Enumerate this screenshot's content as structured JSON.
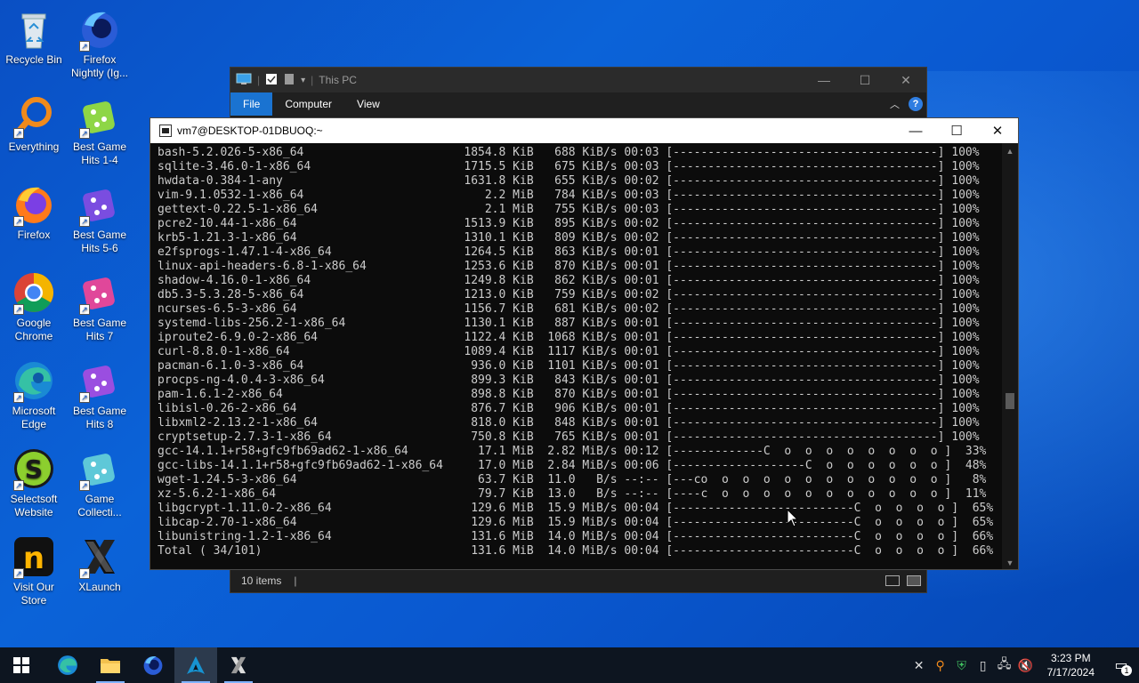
{
  "desktop": {
    "icons": [
      {
        "label": "Recycle Bin",
        "icon": "recycle-bin-icon"
      },
      {
        "label": "Firefox Nightly (Ig...",
        "icon": "firefox-nightly-icon"
      },
      {
        "label": "Everything",
        "icon": "everything-search-icon"
      },
      {
        "label": "Best Game Hits 1-4",
        "icon": "game-dice-icon"
      },
      {
        "label": "Firefox",
        "icon": "firefox-icon"
      },
      {
        "label": "Best Game Hits 5-6",
        "icon": "game-dice-icon"
      },
      {
        "label": "Google Chrome",
        "icon": "chrome-icon"
      },
      {
        "label": "Best Game Hits 7",
        "icon": "game-dice-icon"
      },
      {
        "label": "Microsoft Edge",
        "icon": "edge-icon"
      },
      {
        "label": "Best Game Hits 8",
        "icon": "game-dice-icon"
      },
      {
        "label": "Selectsoft Website",
        "icon": "selectsoft-icon"
      },
      {
        "label": "Game Collecti...",
        "icon": "game-dice-icon"
      },
      {
        "label": "Visit Our Store",
        "icon": "store-icon"
      },
      {
        "label": "XLaunch",
        "icon": "xlaunch-icon"
      }
    ]
  },
  "explorer": {
    "title": "This PC",
    "tabs": [
      "File",
      "Computer",
      "View"
    ],
    "status": "10 items",
    "status_sep": "|",
    "help_label": "?"
  },
  "terminal": {
    "title": "vm7@DESKTOP-01DBUOQ:~",
    "lines": [
      "bash-5.2.026-5-x86_64                       1854.8 KiB   688 KiB/s 00:03 [--------------------------------------] 100%",
      "sqlite-3.46.0-1-x86_64                      1715.5 KiB   675 KiB/s 00:03 [--------------------------------------] 100%",
      "hwdata-0.384-1-any                          1631.8 KiB   655 KiB/s 00:02 [--------------------------------------] 100%",
      "vim-9.1.0532-1-x86_64                          2.2 MiB   784 KiB/s 00:03 [--------------------------------------] 100%",
      "gettext-0.22.5-1-x86_64                        2.1 MiB   755 KiB/s 00:03 [--------------------------------------] 100%",
      "pcre2-10.44-1-x86_64                        1513.9 KiB   895 KiB/s 00:02 [--------------------------------------] 100%",
      "krb5-1.21.3-1-x86_64                        1310.1 KiB   809 KiB/s 00:02 [--------------------------------------] 100%",
      "e2fsprogs-1.47.1-4-x86_64                   1264.5 KiB   863 KiB/s 00:01 [--------------------------------------] 100%",
      "linux-api-headers-6.8-1-x86_64              1253.6 KiB   870 KiB/s 00:01 [--------------------------------------] 100%",
      "shadow-4.16.0-1-x86_64                      1249.8 KiB   862 KiB/s 00:01 [--------------------------------------] 100%",
      "db5.3-5.3.28-5-x86_64                       1213.0 KiB   759 KiB/s 00:02 [--------------------------------------] 100%",
      "ncurses-6.5-3-x86_64                        1156.7 KiB   681 KiB/s 00:02 [--------------------------------------] 100%",
      "systemd-libs-256.2-1-x86_64                 1130.1 KiB   887 KiB/s 00:01 [--------------------------------------] 100%",
      "iproute2-6.9.0-2-x86_64                     1122.4 KiB  1068 KiB/s 00:01 [--------------------------------------] 100%",
      "curl-8.8.0-1-x86_64                         1089.4 KiB  1117 KiB/s 00:01 [--------------------------------------] 100%",
      "pacman-6.1.0-3-x86_64                        936.0 KiB  1101 KiB/s 00:01 [--------------------------------------] 100%",
      "procps-ng-4.0.4-3-x86_64                     899.3 KiB   843 KiB/s 00:01 [--------------------------------------] 100%",
      "pam-1.6.1-2-x86_64                           898.8 KiB   870 KiB/s 00:01 [--------------------------------------] 100%",
      "libisl-0.26-2-x86_64                         876.7 KiB   906 KiB/s 00:01 [--------------------------------------] 100%",
      "libxml2-2.13.2-1-x86_64                      818.0 KiB   848 KiB/s 00:01 [--------------------------------------] 100%",
      "cryptsetup-2.7.3-1-x86_64                    750.8 KiB   765 KiB/s 00:01 [--------------------------------------] 100%",
      "gcc-14.1.1+r58+gfc9fb69ad62-1-x86_64          17.1 MiB  2.82 MiB/s 00:12 [-------------C  o  o  o  o  o  o  o  o ]  33%",
      "gcc-libs-14.1.1+r58+gfc9fb69ad62-1-x86_64     17.0 MiB  2.84 MiB/s 00:06 [-------------------C  o  o  o  o  o  o ]  48%",
      "wget-1.24.5-3-x86_64                          63.7 KiB  11.0   B/s --:-- [---co  o  o  o  o  o  o  o  o  o  o  o ]   8%",
      "xz-5.6.2-1-x86_64                             79.7 KiB  13.0   B/s --:-- [----c  o  o  o  o  o  o  o  o  o  o  o ]  11%",
      "libgcrypt-1.11.0-2-x86_64                    129.6 MiB  15.9 MiB/s 00:04 [--------------------------C  o  o  o  o ]  65%",
      "libcap-2.70-1-x86_64                         129.6 MiB  15.9 MiB/s 00:04 [--------------------------C  o  o  o  o ]  65%",
      "libunistring-1.2-1-x86_64                    131.6 MiB  14.0 MiB/s 00:04 [--------------------------C  o  o  o  o ]  66%",
      "Total ( 34/101)                              131.6 MiB  14.0 MiB/s 00:04 [--------------------------C  o  o  o  o ]  66%"
    ]
  },
  "taskbar": {
    "buttons": [
      "start-icon",
      "edge-icon",
      "file-explorer-icon",
      "firefox-nightly-icon",
      "arch-terminal-icon",
      "xlaunch-icon"
    ],
    "time": "3:23 PM",
    "date": "7/17/2024",
    "notification_count": "1"
  }
}
